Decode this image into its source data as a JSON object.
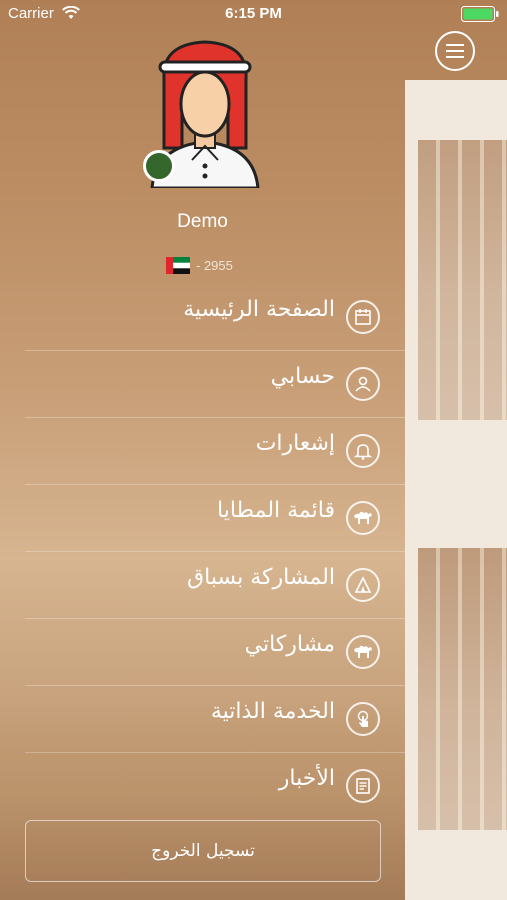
{
  "status_bar": {
    "carrier": "Carrier",
    "time": "6:15 PM"
  },
  "profile": {
    "name": "Demo",
    "id": "- 2955"
  },
  "menu": {
    "items": [
      {
        "label": "الصفحة الرئيسية",
        "icon": "home-calendar-icon"
      },
      {
        "label": "حسابي",
        "icon": "user-icon"
      },
      {
        "label": "إشعارات",
        "icon": "bell-icon"
      },
      {
        "label": "قائمة المطايا",
        "icon": "camel-icon"
      },
      {
        "label": "المشاركة بسباق",
        "icon": "tent-icon"
      },
      {
        "label": "مشاركاتي",
        "icon": "camel-icon"
      },
      {
        "label": "الخدمة الذاتية",
        "icon": "touch-icon"
      },
      {
        "label": "الأخبار",
        "icon": "newspaper-icon"
      }
    ]
  },
  "logout": {
    "label": "تسجيل الخروج"
  },
  "colors": {
    "accent": "#35662b",
    "background": "#bb8c62",
    "panel": "#f1e9de"
  }
}
